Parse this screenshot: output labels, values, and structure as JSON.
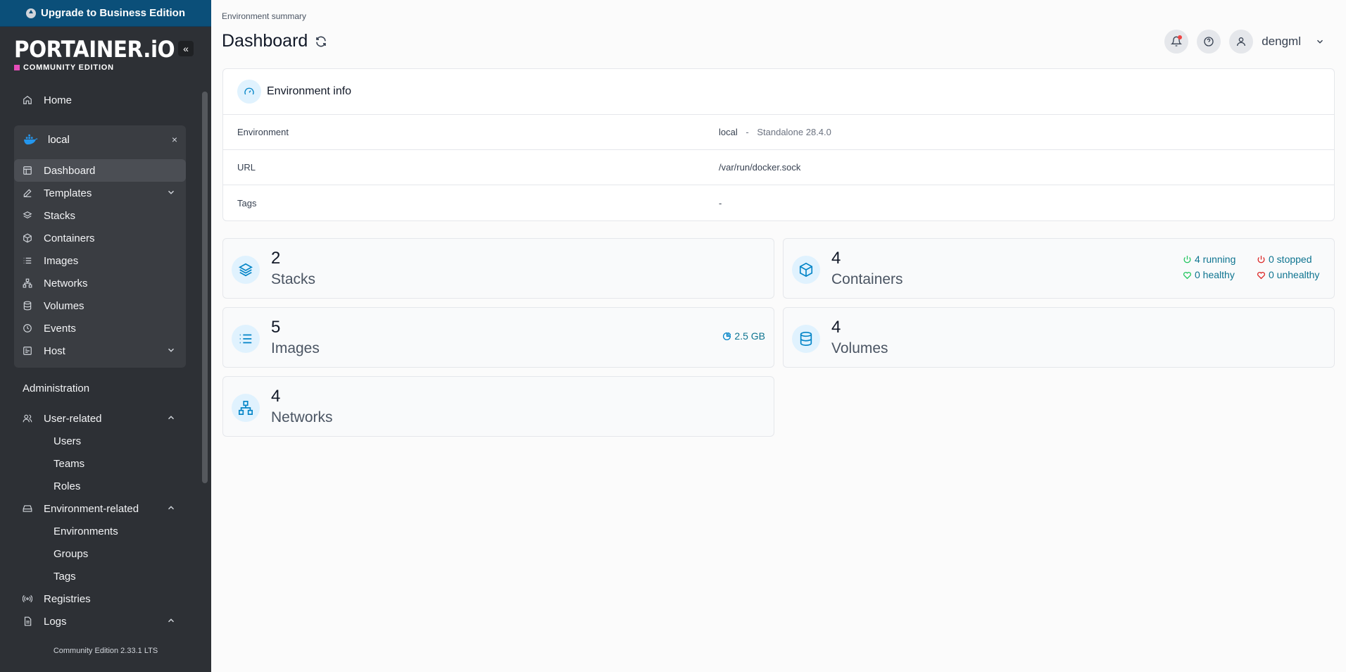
{
  "banner": {
    "label": "Upgrade to Business Edition"
  },
  "brand": {
    "logo": "PORTAINER.iO",
    "edition": "COMMUNITY EDITION"
  },
  "sidebar": {
    "home": "Home",
    "environment": {
      "name": "local",
      "close": "×"
    },
    "env_items": [
      {
        "label": "Dashboard"
      },
      {
        "label": "Templates"
      },
      {
        "label": "Stacks"
      },
      {
        "label": "Containers"
      },
      {
        "label": "Images"
      },
      {
        "label": "Networks"
      },
      {
        "label": "Volumes"
      },
      {
        "label": "Events"
      },
      {
        "label": "Host"
      }
    ],
    "administration": "Administration",
    "user_related": {
      "label": "User-related",
      "items": [
        "Users",
        "Teams",
        "Roles"
      ]
    },
    "environment_related": {
      "label": "Environment-related",
      "items": [
        "Environments",
        "Groups",
        "Tags"
      ]
    },
    "registries": "Registries",
    "logs": "Logs",
    "footer": "Community Edition 2.33.1 LTS"
  },
  "header": {
    "breadcrumb": "Environment summary",
    "title": "Dashboard",
    "username": "dengml"
  },
  "env_info": {
    "title": "Environment info",
    "rows": [
      {
        "key": "Environment",
        "value": "local",
        "sep": "-",
        "extra": "Standalone 28.4.0"
      },
      {
        "key": "URL",
        "value": "/var/run/docker.sock"
      },
      {
        "key": "Tags",
        "value": "-"
      }
    ]
  },
  "stats": {
    "stacks": {
      "count": "2",
      "label": "Stacks"
    },
    "containers": {
      "count": "4",
      "label": "Containers",
      "running": "4 running",
      "stopped": "0 stopped",
      "healthy": "0 healthy",
      "unhealthy": "0 unhealthy"
    },
    "images": {
      "count": "5",
      "label": "Images",
      "size": "2.5 GB"
    },
    "volumes": {
      "count": "4",
      "label": "Volumes"
    },
    "networks": {
      "count": "4",
      "label": "Networks"
    }
  },
  "colors": {
    "accent": "#0b4f79",
    "sidebar": "#2d3035",
    "icon": "#0284c7",
    "green": "#22c55e",
    "red": "#dc2626"
  }
}
